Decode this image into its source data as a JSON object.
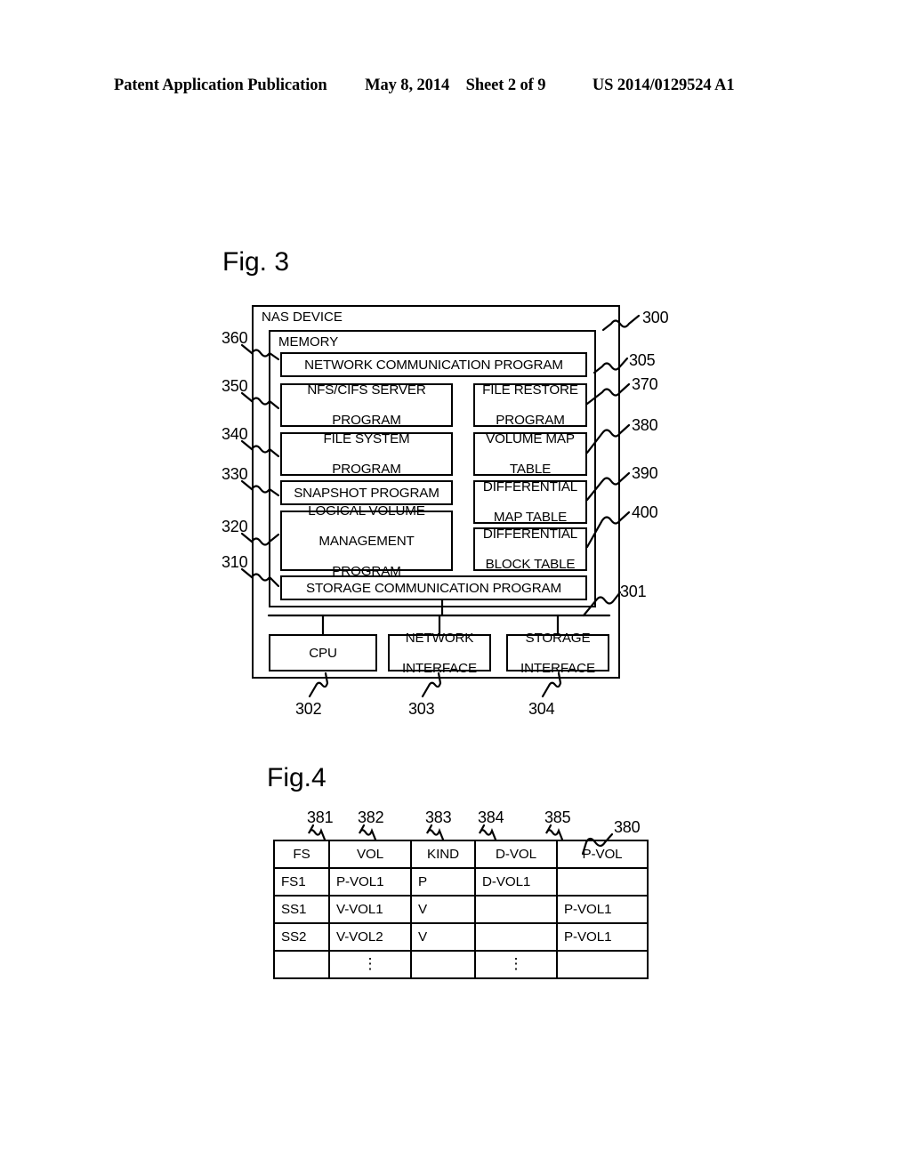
{
  "header": {
    "publication": "Patent Application Publication",
    "date": "May 8, 2014",
    "sheet": "Sheet 2 of 9",
    "number": "US 2014/0129524 A1"
  },
  "fig3": {
    "label": "Fig. 3",
    "outer_box_title": "NAS DEVICE",
    "memory_box_title": "MEMORY",
    "full_width_blocks": [
      {
        "text": "NETWORK COMMUNICATION PROGRAM"
      },
      {
        "text": "STORAGE COMMUNICATION PROGRAM"
      }
    ],
    "left_column_blocks": [
      {
        "line1": "NFS/CIFS SERVER",
        "line2": "PROGRAM"
      },
      {
        "line1": "FILE SYSTEM",
        "line2": "PROGRAM"
      },
      {
        "line1": "SNAPSHOT PROGRAM",
        "line2": ""
      },
      {
        "line1": "LOGICAL VOLUME",
        "line2": "MANAGEMENT",
        "line3": "PROGRAM"
      }
    ],
    "right_column_blocks": [
      {
        "line1": "FILE RESTORE",
        "line2": "PROGRAM"
      },
      {
        "line1": "VOLUME MAP",
        "line2": "TABLE"
      },
      {
        "line1": "DIFFERENTIAL",
        "line2": "MAP TABLE"
      },
      {
        "line1": "DIFFERENTIAL",
        "line2": "BLOCK TABLE"
      }
    ],
    "hardware_blocks": [
      {
        "line1": "CPU",
        "line2": ""
      },
      {
        "line1": "NETWORK",
        "line2": "INTERFACE"
      },
      {
        "line1": "STORAGE",
        "line2": "INTERFACE"
      }
    ],
    "ref_left": [
      "360",
      "350",
      "340",
      "330",
      "320",
      "310"
    ],
    "ref_right": [
      "300",
      "305",
      "370",
      "380",
      "390",
      "400",
      "301"
    ],
    "ref_bottom": [
      "302",
      "303",
      "304"
    ]
  },
  "fig4": {
    "label": "Fig.4",
    "column_refs": [
      "381",
      "382",
      "383",
      "384",
      "385"
    ],
    "table_ref": "380",
    "columns": [
      "FS",
      "VOL",
      "KIND",
      "D-VOL",
      "P-VOL"
    ],
    "rows": [
      [
        "FS1",
        "P-VOL1",
        "P",
        "D-VOL1",
        ""
      ],
      [
        "SS1",
        "V-VOL1",
        "V",
        "",
        "P-VOL1"
      ],
      [
        "SS2",
        "V-VOL2",
        "V",
        "",
        "P-VOL1"
      ]
    ],
    "ellipsis_row": [
      "",
      "⋮",
      "",
      "⋮",
      ""
    ]
  },
  "colors": {
    "ink": "#000000",
    "paper": "#ffffff"
  }
}
